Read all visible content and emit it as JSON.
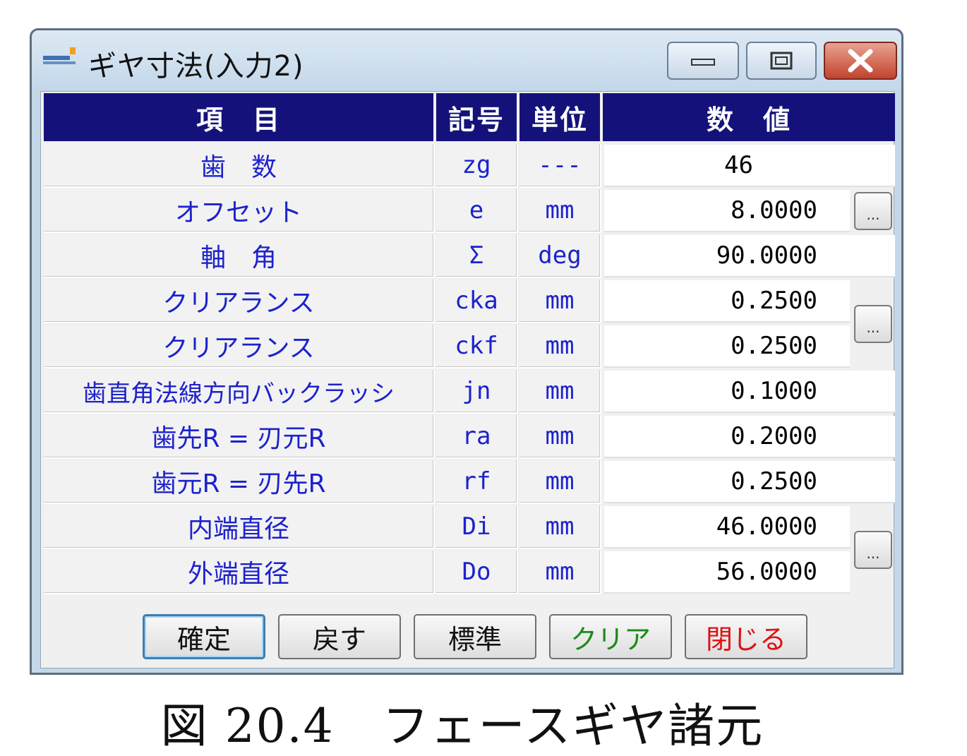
{
  "window": {
    "title": "ギヤ寸法(入力2)"
  },
  "table": {
    "headers": {
      "item": "項　目",
      "symbol": "記号",
      "unit": "単位",
      "value": "数　値"
    },
    "rows": [
      {
        "item": "歯　数",
        "symbol": "zg",
        "unit": "---",
        "value": "46"
      },
      {
        "item": "オフセット",
        "symbol": "e",
        "unit": "mm",
        "value": "8.0000"
      },
      {
        "item": "軸　角",
        "symbol": "Σ",
        "unit": "deg",
        "value": "90.0000"
      },
      {
        "item": "クリアランス",
        "symbol": "cka",
        "unit": "mm",
        "value": "0.2500"
      },
      {
        "item": "クリアランス",
        "symbol": "ckf",
        "unit": "mm",
        "value": "0.2500"
      },
      {
        "item": "歯直角法線方向バックラッシ",
        "symbol": "jn",
        "unit": "mm",
        "value": "0.1000"
      },
      {
        "item": "歯先R = 刃元R",
        "symbol": "ra",
        "unit": "mm",
        "value": "0.2000"
      },
      {
        "item": "歯元R = 刃先R",
        "symbol": "rf",
        "unit": "mm",
        "value": "0.2500"
      },
      {
        "item": "内端直径",
        "symbol": "Di",
        "unit": "mm",
        "value": "46.0000"
      },
      {
        "item": "外端直径",
        "symbol": "Do",
        "unit": "mm",
        "value": "56.0000"
      }
    ],
    "ellipsis_label": "..."
  },
  "buttons": {
    "confirm": "確定",
    "revert": "戻す",
    "standard": "標準",
    "clear": "クリア",
    "close": "閉じる"
  },
  "colors": {
    "header_bg": "#14127a",
    "item_text": "#1c22cc",
    "clear_text": "#1a8a1a",
    "close_text": "#e01010"
  },
  "caption": "図 20.4　フェースギヤ諸元"
}
